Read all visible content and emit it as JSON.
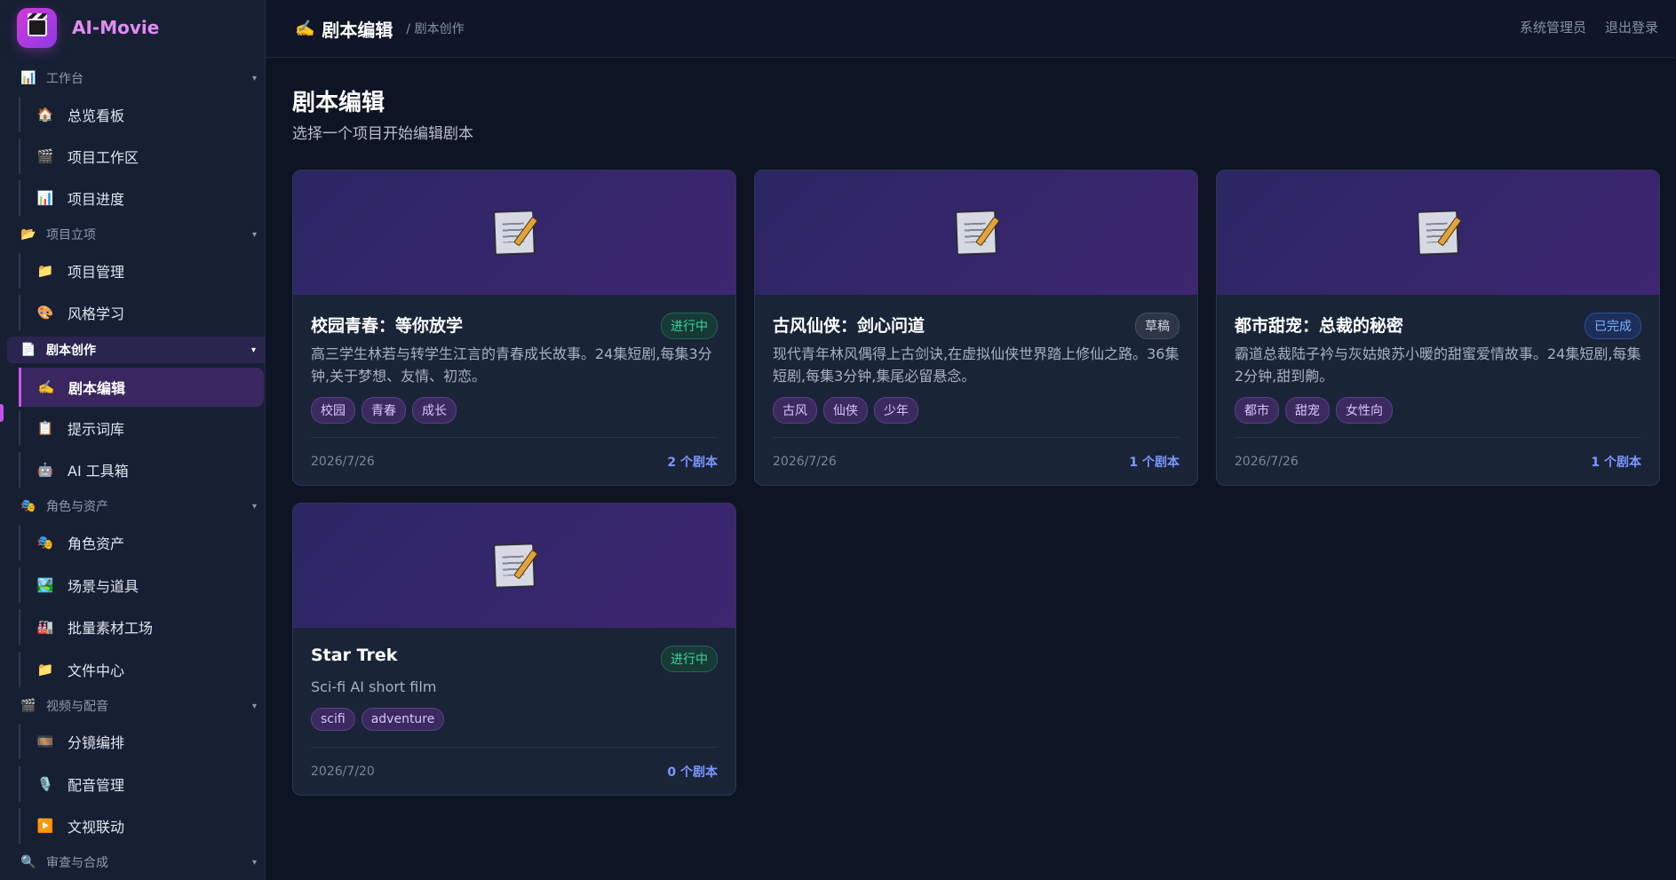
{
  "app": {
    "name": "AI-Movie"
  },
  "header": {
    "icon": "✍️",
    "title": "剧本编辑",
    "breadcrumb": "/ 剧本创作",
    "user": "系统管理员",
    "logout": "退出登录"
  },
  "page": {
    "title": "剧本编辑",
    "subtitle": "选择一个项目开始编辑剧本"
  },
  "sidebar": {
    "sections": [
      {
        "label": "工作台",
        "icon": "📊",
        "items": [
          {
            "label": "总览看板",
            "icon": "🏠"
          },
          {
            "label": "项目工作区",
            "icon": "🎬"
          },
          {
            "label": "项目进度",
            "icon": "📊"
          }
        ]
      },
      {
        "label": "项目立项",
        "icon": "📂",
        "items": [
          {
            "label": "项目管理",
            "icon": "📁"
          },
          {
            "label": "风格学习",
            "icon": "🎨"
          }
        ]
      },
      {
        "label": "剧本创作",
        "icon": "📄",
        "items": [
          {
            "label": "剧本编辑",
            "icon": "✍️"
          },
          {
            "label": "提示词库",
            "icon": "📋"
          },
          {
            "label": "AI 工具箱",
            "icon": "🤖"
          }
        ]
      },
      {
        "label": "角色与资产",
        "icon": "🎭",
        "items": [
          {
            "label": "角色资产",
            "icon": "🎭"
          },
          {
            "label": "场景与道具",
            "icon": "🏞️"
          },
          {
            "label": "批量素材工场",
            "icon": "🏭"
          },
          {
            "label": "文件中心",
            "icon": "📁"
          }
        ]
      },
      {
        "label": "视频与配音",
        "icon": "🎬",
        "items": [
          {
            "label": "分镜编排",
            "icon": "🎞️"
          },
          {
            "label": "配音管理",
            "icon": "🎙️"
          },
          {
            "label": "文视联动",
            "icon": "▶️"
          }
        ]
      },
      {
        "label": "审查与合成",
        "icon": "🔍",
        "items": []
      }
    ]
  },
  "cards": [
    {
      "title": "校园青春：等你放学",
      "status": "进行中",
      "desc": "高三学生林若与转学生江言的青春成长故事。24集短剧,每集3分钟,关于梦想、友情、初恋。",
      "tags": [
        "校园",
        "青春",
        "成长"
      ],
      "date": "2026/7/26",
      "count": "2 个剧本"
    },
    {
      "title": "古风仙侠：剑心问道",
      "status": "草稿",
      "desc": "现代青年林风偶得上古剑诀,在虚拟仙侠世界踏上修仙之路。36集短剧,每集3分钟,集尾必留悬念。",
      "tags": [
        "古风",
        "仙侠",
        "少年"
      ],
      "date": "2026/7/26",
      "count": "1 个剧本"
    },
    {
      "title": "都市甜宠：总裁的秘密",
      "status": "已完成",
      "desc": "霸道总裁陆子衿与灰姑娘苏小暖的甜蜜爱情故事。24集短剧,每集2分钟,甜到齁。",
      "tags": [
        "都市",
        "甜宠",
        "女性向"
      ],
      "date": "2026/7/26",
      "count": "1 个剧本"
    },
    {
      "title": "Star Trek",
      "status": "进行中",
      "desc": "Sci-fi AI short film",
      "tags": [
        "scifi",
        "adventure"
      ],
      "date": "2026/7/20",
      "count": "0 个剧本"
    }
  ],
  "colors": {
    "accent": "#c955ee",
    "status_in_progress": "#39d79b",
    "status_draft": "#d3d7e2",
    "status_done": "#7eb0ff",
    "link": "#7b96ff"
  }
}
